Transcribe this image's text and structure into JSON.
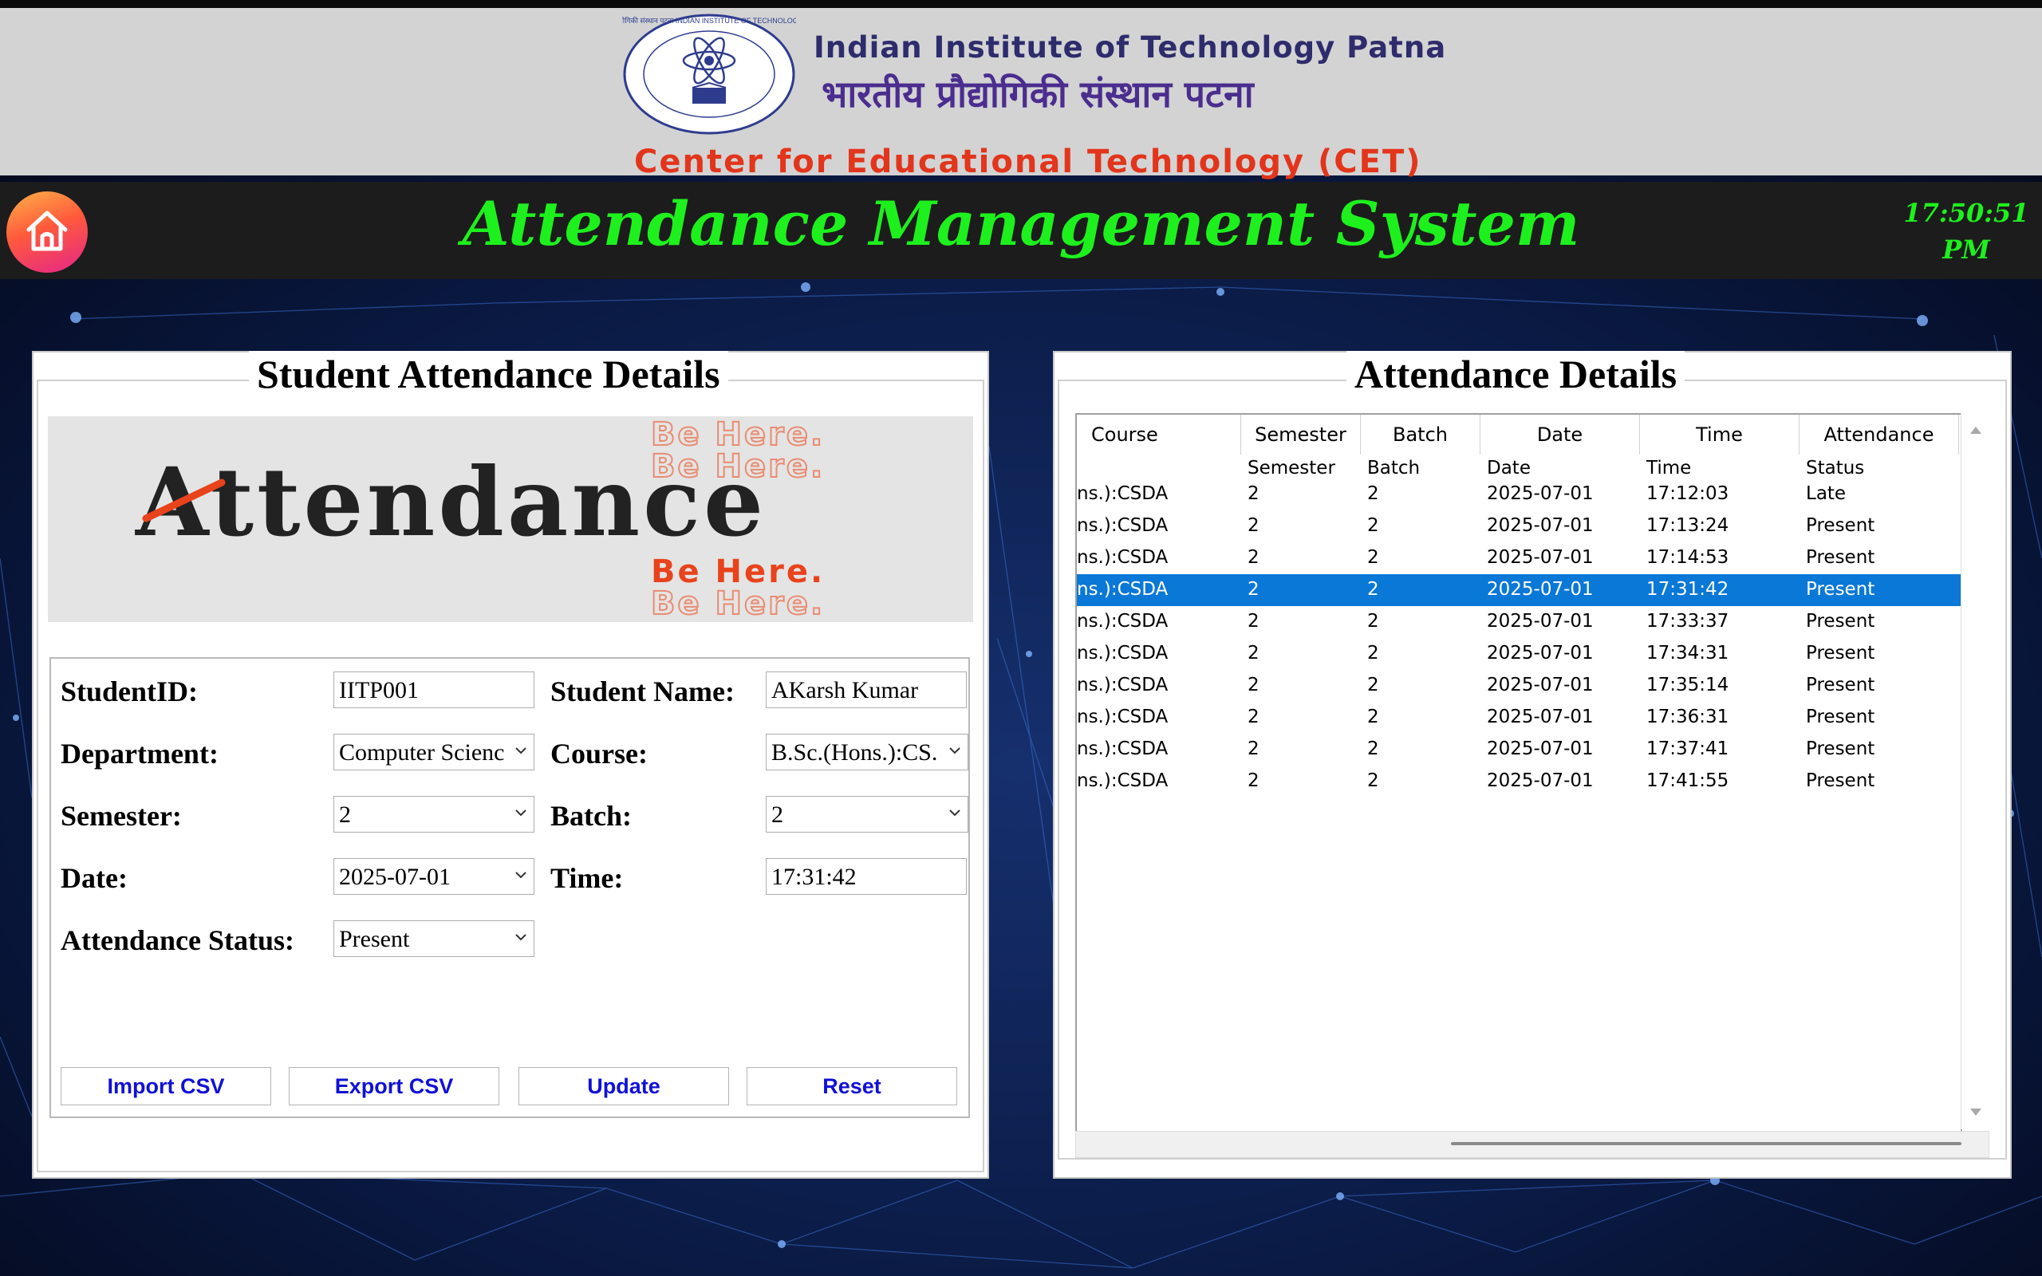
{
  "header": {
    "institute_en": "Indian Institute of Technology Patna",
    "institute_hi": "भारतीय प्रौद्योगिकी संस्थान पटना",
    "center": "Center for Educational Technology (CET)",
    "logo_icon": "iit-patna-seal-logo",
    "logo_text": "भारतीय प्रौद्योगिकी संस्थान पटना INDIAN INSTITUTE OF TECHNOLOGY PATNA"
  },
  "titlebar": {
    "home_icon": "home-icon",
    "title": "Attendance Management System",
    "clock_time": "17:50:51",
    "clock_ampm": "PM",
    "accent": "#1ef01e"
  },
  "left_panel": {
    "title": "Student Attendance Details",
    "banner": {
      "word": "Attendance",
      "tagline": "Be Here."
    },
    "form": {
      "student_id_label": "StudentID:",
      "student_id_value": "IITP001",
      "student_name_label": "Student Name:",
      "student_name_value": "AKarsh Kumar",
      "department_label": "Department:",
      "department_value": "Computer Scienc",
      "course_label": "Course:",
      "course_value": "B.Sc.(Hons.):CS.",
      "semester_label": "Semester:",
      "semester_value": "2",
      "batch_label": "Batch:",
      "batch_value": "2",
      "date_label": "Date:",
      "date_value": "2025-07-01",
      "time_label": "Time:",
      "time_value": "17:31:42",
      "status_label": "Attendance Status:",
      "status_value": "Present"
    },
    "buttons": {
      "import": "Import CSV",
      "export": "Export CSV",
      "update": "Update",
      "reset": "Reset"
    },
    "button_text_color": "#1010d8"
  },
  "right_panel": {
    "title": "Attendance Details",
    "columns": [
      "Course",
      "Semester",
      "Batch",
      "Date",
      "Time",
      "Attendance"
    ],
    "subheaders": [
      "Semester",
      "Batch",
      "Date",
      "Time",
      "Status"
    ],
    "rows": [
      [
        "ns.):CSDA",
        "2",
        "2",
        "2025-07-01",
        "17:12:03",
        "Late"
      ],
      [
        "ns.):CSDA",
        "2",
        "2",
        "2025-07-01",
        "17:13:24",
        "Present"
      ],
      [
        "ns.):CSDA",
        "2",
        "2",
        "2025-07-01",
        "17:14:53",
        "Present"
      ],
      [
        "ns.):CSDA",
        "2",
        "2",
        "2025-07-01",
        "17:31:42",
        "Present"
      ],
      [
        "ns.):CSDA",
        "2",
        "2",
        "2025-07-01",
        "17:33:37",
        "Present"
      ],
      [
        "ns.):CSDA",
        "2",
        "2",
        "2025-07-01",
        "17:34:31",
        "Present"
      ],
      [
        "ns.):CSDA",
        "2",
        "2",
        "2025-07-01",
        "17:35:14",
        "Present"
      ],
      [
        "ns.):CSDA",
        "2",
        "2",
        "2025-07-01",
        "17:36:31",
        "Present"
      ],
      [
        "ns.):CSDA",
        "2",
        "2",
        "2025-07-01",
        "17:37:41",
        "Present"
      ],
      [
        "ns.):CSDA",
        "2",
        "2",
        "2025-07-01",
        "17:41:55",
        "Present"
      ]
    ],
    "selected_row_index": 3,
    "selection_color": "#0a78d7"
  }
}
